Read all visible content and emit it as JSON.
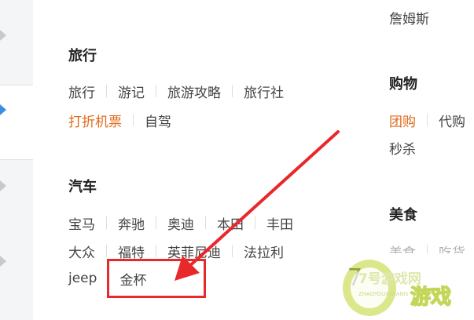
{
  "colors": {
    "accent": "#e06a1b",
    "active_tab": "#3a8ee6",
    "arrow": "#e8282b"
  },
  "top_right": {
    "name": "詹姆斯"
  },
  "travel": {
    "title": "旅行",
    "row1": [
      "旅行",
      "游记",
      "旅游攻略",
      "旅行社"
    ],
    "row2": [
      "打折机票",
      "自驾"
    ]
  },
  "shopping": {
    "title": "购物",
    "row1": [
      "团购",
      "代购"
    ],
    "row2": [
      "秒杀"
    ]
  },
  "cars": {
    "title": "汽车",
    "row1": [
      "宝马",
      "奔驰",
      "奥迪",
      "本田",
      "丰田"
    ],
    "row2": [
      "大众",
      "福特",
      "英菲尼迪",
      "法拉利"
    ],
    "row3": [
      "jeep",
      "金杯"
    ]
  },
  "food": {
    "title": "美食",
    "row1": [
      "美食",
      "吃货"
    ]
  },
  "watermark": {
    "digit": "7",
    "brand": "7号游戏网",
    "brand_sub": "游戏",
    "pinyin": "ZHAOYOUXIWANG"
  }
}
